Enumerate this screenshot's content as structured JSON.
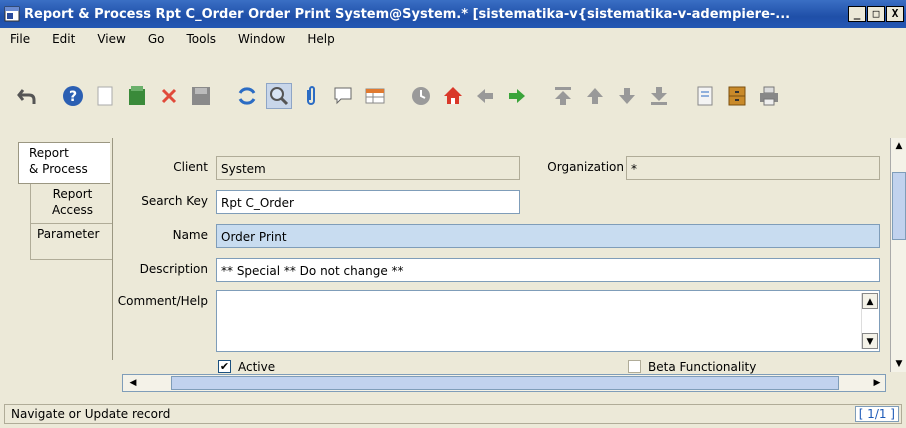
{
  "window": {
    "title": "Report & Process  Rpt C_Order  Order Print  System@System.* [sistematika-v{sistematika-v-adempiere-...",
    "minimize": "_",
    "restore": "□",
    "close": "X"
  },
  "menu": [
    "File",
    "Edit",
    "View",
    "Go",
    "Tools",
    "Window",
    "Help"
  ],
  "toolbar": [
    "undo-icon",
    "help-icon",
    "new-icon",
    "save-copy-icon",
    "delete-icon",
    "save-icon",
    "refresh-icon",
    "find-icon",
    "attachment-icon",
    "chat-icon",
    "grid-toggle-icon",
    "history-icon",
    "home-icon",
    "back-icon",
    "forward-icon",
    "first-record-icon",
    "previous-record-icon",
    "next-record-icon",
    "last-record-icon",
    "report-icon",
    "archive-icon",
    "print-icon"
  ],
  "tabs": [
    "Report\n& Process",
    "Report\nAccess",
    "Parameter"
  ],
  "form": {
    "client_label": "Client",
    "client_value": "System",
    "org_label": "Organization",
    "org_value": "*",
    "searchkey_label": "Search Key",
    "searchkey_value": "Rpt C_Order",
    "name_label": "Name",
    "name_value": "Order Print",
    "description_label": "Description",
    "description_value": "** Special ** Do not change **",
    "comment_label": "Comment/Help",
    "comment_value": "",
    "active_label": "Active",
    "active_checked": true,
    "beta_label": "Beta Functionality",
    "beta_checked": false
  },
  "status": {
    "message": "Navigate or Update record",
    "count": "[ 1/1 ]"
  },
  "colors": {
    "titlebar": "#2357b3",
    "mandatory": "#c8dcf0",
    "readonly": "#ece9d8",
    "background": "#ece9d8"
  }
}
